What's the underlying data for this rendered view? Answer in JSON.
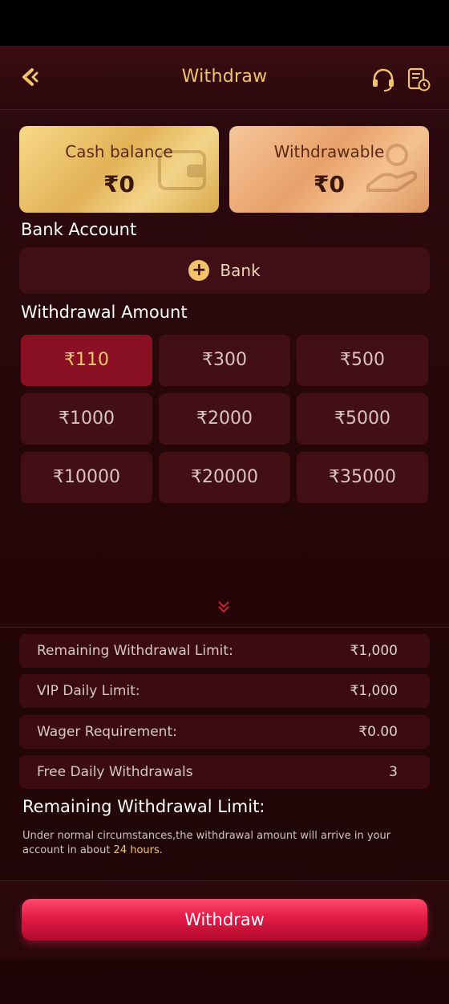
{
  "header": {
    "title": "Withdraw",
    "back_icon": "chevron-left-icon",
    "support_icon": "headset-icon",
    "history_icon": "record-history-icon"
  },
  "balances": {
    "cash": {
      "label": "Cash balance",
      "value": "₹0"
    },
    "withdrawable": {
      "label": "Withdrawable",
      "value": "₹0"
    }
  },
  "bank": {
    "section_label": "Bank Account",
    "button_label": "Bank"
  },
  "amounts": {
    "section_label": "Withdrawal Amount",
    "options": [
      "₹110",
      "₹300",
      "₹500",
      "₹1000",
      "₹2000",
      "₹5000",
      "₹10000",
      "₹20000",
      "₹35000"
    ],
    "selected": "₹110"
  },
  "limits": [
    {
      "label": "Remaining Withdrawal Limit:",
      "value": "₹1,000"
    },
    {
      "label": "VIP Daily Limit:",
      "value": "₹1,000"
    },
    {
      "label": "Wager Requirement:",
      "value": "₹0.00"
    },
    {
      "label": "Free Daily Withdrawals",
      "value": "3"
    }
  ],
  "note": {
    "title": "Remaining Withdrawal Limit:",
    "text_before": "Under normal circumstances,the withdrawal amount will arrive in your account in about ",
    "highlight": "24 hours",
    "text_after": "."
  },
  "footer": {
    "withdraw_label": "Withdraw"
  },
  "colors": {
    "accent_gold": "#f2c46a",
    "primary_red": "#e21a46",
    "selected_amount": "#8a1024"
  }
}
